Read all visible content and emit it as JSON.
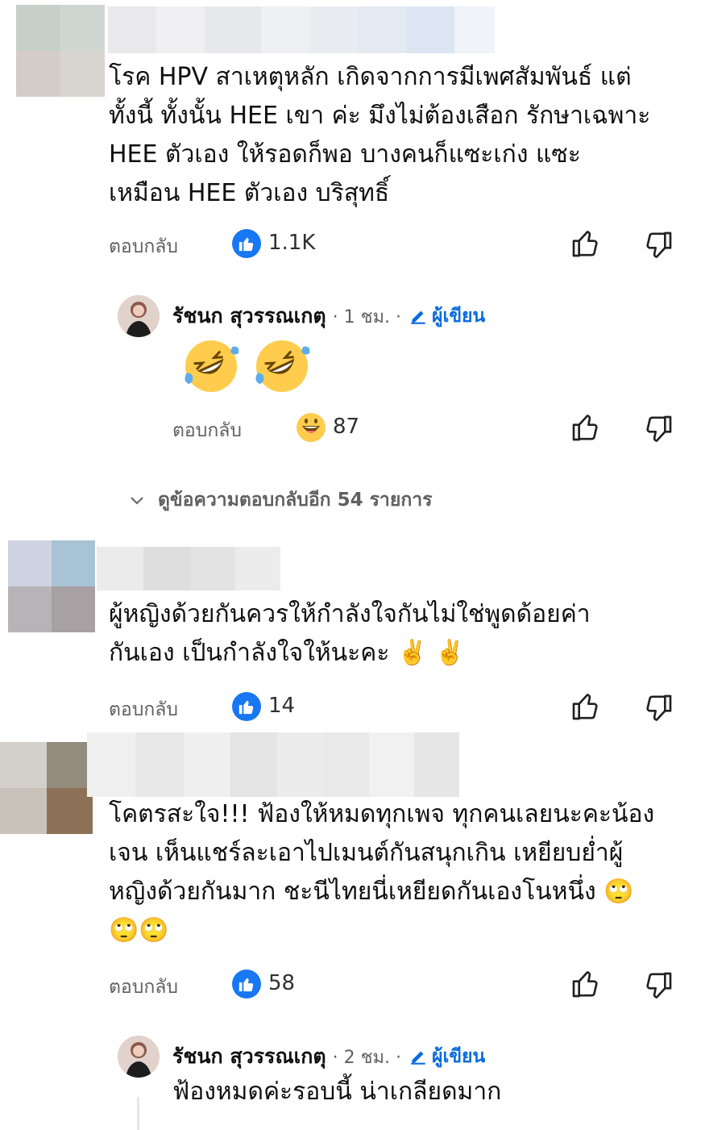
{
  "comments": [
    {
      "text": "โรค HPV สาเหตุหลัก เกิดจากการมีเพศสัมพันธ์ แต่\nทั้งนี้ ทั้งนั้น HEE เขา ค่ะ มึงไม่ต้องเสือก รักษาเฉพาะ\nHEE ตัวเอง ให้รอดก็พอ บางคนก็แซะเก่ง แซะ\nเหมือน HEE ตัวเอง บริสุทธิ์",
      "reply_label": "ตอบกลับ",
      "like_count": "1.1K",
      "reply": {
        "author": "รัชนก สุวรรณเกตุ",
        "time": "· 1 ชม. ·",
        "badge": "ผู้เขียน",
        "text": "🤣 🤣",
        "reply_label": "ตอบกลับ",
        "reaction_count": "87"
      },
      "more_replies": "ดูข้อความตอบกลับอีก 54 รายการ"
    },
    {
      "text": "ผู้หญิงด้วยกันควรให้กำลังใจกันไม่ใช่พูดด้อยค่า\nกันเอง  เป็นกำลังใจให้นะคะ ✌️ ✌️",
      "reply_label": "ตอบกลับ",
      "like_count": "14"
    },
    {
      "text": "โคตรสะใจ!!! ฟ้องให้หมดทุกเพจ ทุกคนเลยนะคะน้อง\nเจน เห็นแชร์ละเอาไปเมนต์กันสนุกเกิน เหยียบย่ำผู้\nหญิงด้วยกันมาก ชะนีไทยนี่เหยียดกันเองโนหนึ่ง 🙄\n🙄🙄",
      "reply_label": "ตอบกลับ",
      "like_count": "58",
      "reply": {
        "author": "รัชนก สุวรรณเกตุ",
        "time": "· 2 ชม. ·",
        "badge": "ผู้เขียน",
        "text": "ฟ้องหมดค่ะรอบนี้ น่าเกลียดมาก"
      }
    }
  ],
  "colors": {
    "like_blue": "#1877f2",
    "author_badge": "#0a6cde",
    "secondary_text": "#606060"
  },
  "icons": [
    "like-badge-icon",
    "thumbs-up-icon",
    "thumbs-down-icon",
    "pencil-icon",
    "chevron-down-icon",
    "grinning-emoji-icon"
  ]
}
